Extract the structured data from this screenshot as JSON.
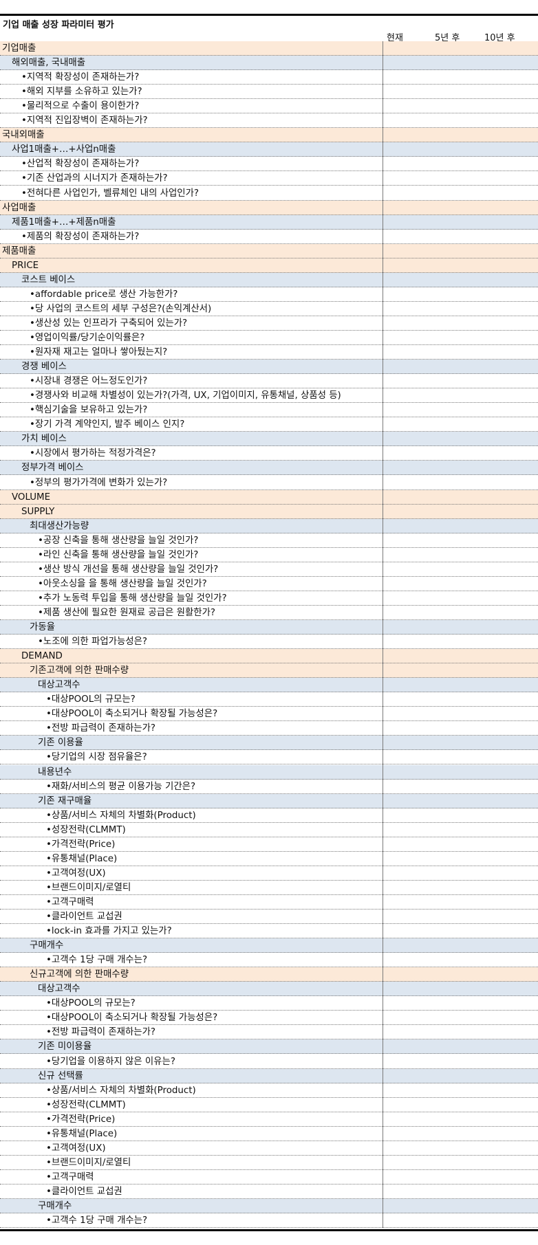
{
  "title": "기업 매출 성장 파라미터 평가",
  "columns": [
    "현재",
    "5년 후",
    "10년 후"
  ],
  "colors": {
    "orange_row": "#fce9d8",
    "blue_row": "#dde6f0"
  },
  "rows": [
    {
      "text": "기업매출",
      "indent": 0,
      "style": "a"
    },
    {
      "text": "해외매출, 국내매출",
      "indent": 1,
      "style": "b"
    },
    {
      "text": "•지역적 확장성이 존재하는가?",
      "indent": 2,
      "style": "c"
    },
    {
      "text": "•해외 지부를 소유하고 있는가?",
      "indent": 2,
      "style": "c"
    },
    {
      "text": "•물리적으로 수출이 용이한가?",
      "indent": 2,
      "style": "c"
    },
    {
      "text": "•지역적 진입장벽이 존재하는가?",
      "indent": 2,
      "style": "c"
    },
    {
      "text": "국내외매출",
      "indent": 0,
      "style": "a"
    },
    {
      "text": "사업1매출+…+사업n매출",
      "indent": 1,
      "style": "b"
    },
    {
      "text": "•산업적 확장성이 존재하는가?",
      "indent": 2,
      "style": "c"
    },
    {
      "text": "•기존 산업과의 시너지가 존재하는가?",
      "indent": 2,
      "style": "c"
    },
    {
      "text": "•전혀다른 사업인가, 벨류체인 내의 사업인가?",
      "indent": 2,
      "style": "c"
    },
    {
      "text": "사업매출",
      "indent": 0,
      "style": "a"
    },
    {
      "text": "제품1매출+…+제품n매출",
      "indent": 1,
      "style": "b"
    },
    {
      "text": "•제품의 확장성이 존재하는가?",
      "indent": 2,
      "style": "c"
    },
    {
      "text": "제품매출",
      "indent": 0,
      "style": "a"
    },
    {
      "text": "PRICE",
      "indent": 1,
      "style": "a"
    },
    {
      "text": "코스트 베이스",
      "indent": 2,
      "style": "b"
    },
    {
      "text": "•affordable price로 생산 가능한가?",
      "indent": 3,
      "style": "c"
    },
    {
      "text": "•당 사업의 코스트의 세부 구성은?(손익계산서)",
      "indent": 3,
      "style": "c"
    },
    {
      "text": "•생산성 있는 인프라가 구축되어 있는가?",
      "indent": 3,
      "style": "c"
    },
    {
      "text": "•영업이익률/당기순이익률은?",
      "indent": 3,
      "style": "c"
    },
    {
      "text": "•원자재 재고는 얼마나 쌓아뒀는지?",
      "indent": 3,
      "style": "c"
    },
    {
      "text": "경쟁 베이스",
      "indent": 2,
      "style": "b"
    },
    {
      "text": "•시장내 경쟁은 어느정도인가?",
      "indent": 3,
      "style": "c"
    },
    {
      "text": "•경쟁사와 비교해 차별성이 있는가?(가격, UX, 기업이미지, 유통채널, 상품성 등)",
      "indent": 3,
      "style": "c"
    },
    {
      "text": "•핵심기술을 보유하고 있는가?",
      "indent": 3,
      "style": "c"
    },
    {
      "text": "•장기 가격 계약인지, 발주 베이스 인지?",
      "indent": 3,
      "style": "c"
    },
    {
      "text": "가치 베이스",
      "indent": 2,
      "style": "b"
    },
    {
      "text": "•시장에서 평가하는 적정가격은?",
      "indent": 3,
      "style": "c"
    },
    {
      "text": "정부가격 베이스",
      "indent": 2,
      "style": "b"
    },
    {
      "text": "•정부의 평가가격에 변화가 있는가?",
      "indent": 3,
      "style": "c"
    },
    {
      "text": "VOLUME",
      "indent": 1,
      "style": "a"
    },
    {
      "text": "SUPPLY",
      "indent": 2,
      "style": "a"
    },
    {
      "text": "최대생산가능량",
      "indent": 3,
      "style": "b"
    },
    {
      "text": "•공장 신축을 통해 생산량을 늘일 것인가?",
      "indent": 4,
      "style": "c"
    },
    {
      "text": "•라인 신축을 통해 생산량을 늘일 것인가?",
      "indent": 4,
      "style": "c"
    },
    {
      "text": "•생산 방식 개선을 통해 생산량을 늘일 것인가?",
      "indent": 4,
      "style": "c"
    },
    {
      "text": "•아웃소싱을 을 통해 생산량을 늘일 것인가?",
      "indent": 4,
      "style": "c"
    },
    {
      "text": "•추가 노동력 투입을 통해 생산량을 늘일 것인가?",
      "indent": 4,
      "style": "c"
    },
    {
      "text": "•제품 생산에 필요한 원재료 공급은 원활한가?",
      "indent": 4,
      "style": "c"
    },
    {
      "text": "가동율",
      "indent": 3,
      "style": "b"
    },
    {
      "text": "•노조에 의한 파업가능성은?",
      "indent": 4,
      "style": "c"
    },
    {
      "text": "DEMAND",
      "indent": 2,
      "style": "a"
    },
    {
      "text": "기존고객에 의한 판매수량",
      "indent": 3,
      "style": "a"
    },
    {
      "text": "대상고객수",
      "indent": 4,
      "style": "b"
    },
    {
      "text": "•대상POOL의 규모는?",
      "indent": 5,
      "style": "c"
    },
    {
      "text": "•대상POOL이 축소되거나 확장될 가능성은?",
      "indent": 5,
      "style": "c"
    },
    {
      "text": "•전방 파급력이 존재하는가?",
      "indent": 5,
      "style": "c"
    },
    {
      "text": "기존 이용율",
      "indent": 4,
      "style": "b"
    },
    {
      "text": "•당기업의 시장 점유율은?",
      "indent": 5,
      "style": "c"
    },
    {
      "text": "내용년수",
      "indent": 4,
      "style": "b"
    },
    {
      "text": "•재화/서비스의 평균 이용가능 기간은?",
      "indent": 5,
      "style": "c"
    },
    {
      "text": "기존 재구매율",
      "indent": 4,
      "style": "b"
    },
    {
      "text": "•상품/서비스 자체의 차별화(Product)",
      "indent": 5,
      "style": "c"
    },
    {
      "text": "•성장전략(CLMMT)",
      "indent": 5,
      "style": "c"
    },
    {
      "text": "•가격전략(Price)",
      "indent": 5,
      "style": "c"
    },
    {
      "text": "•유통채널(Place)",
      "indent": 5,
      "style": "c"
    },
    {
      "text": "•고객여정(UX)",
      "indent": 5,
      "style": "c"
    },
    {
      "text": "•브랜드이미지/로열티",
      "indent": 5,
      "style": "c"
    },
    {
      "text": "•고객구매력",
      "indent": 5,
      "style": "c"
    },
    {
      "text": "•클라이언트 교섭권",
      "indent": 5,
      "style": "c"
    },
    {
      "text": "•lock-in 효과를 가지고 있는가?",
      "indent": 5,
      "style": "c"
    },
    {
      "text": "구매개수",
      "indent": 3,
      "style": "b"
    },
    {
      "text": "•고객수 1당 구매 개수는?",
      "indent": 5,
      "style": "c"
    },
    {
      "text": "신규고객에 의한 판매수량",
      "indent": 3,
      "style": "a"
    },
    {
      "text": "대상고객수",
      "indent": 4,
      "style": "b"
    },
    {
      "text": "•대상POOL의 규모는?",
      "indent": 5,
      "style": "c"
    },
    {
      "text": "•대상POOL이 축소되거나 확장될 가능성은?",
      "indent": 5,
      "style": "c"
    },
    {
      "text": "•전방 파급력이 존재하는가?",
      "indent": 5,
      "style": "c"
    },
    {
      "text": "기존 미이용율",
      "indent": 4,
      "style": "b"
    },
    {
      "text": "•당기업을 이용하지 않은 이유는?",
      "indent": 5,
      "style": "c"
    },
    {
      "text": "신규 선택률",
      "indent": 4,
      "style": "b"
    },
    {
      "text": "•상품/서비스 자체의 차별화(Product)",
      "indent": 5,
      "style": "c"
    },
    {
      "text": "•성장전략(CLMMT)",
      "indent": 5,
      "style": "c"
    },
    {
      "text": "•가격전략(Price)",
      "indent": 5,
      "style": "c"
    },
    {
      "text": "•유통채널(Place)",
      "indent": 5,
      "style": "c"
    },
    {
      "text": "•고객여정(UX)",
      "indent": 5,
      "style": "c"
    },
    {
      "text": "•브랜드이미지/로열티",
      "indent": 5,
      "style": "c"
    },
    {
      "text": "•고객구매력",
      "indent": 5,
      "style": "c"
    },
    {
      "text": "•클라이언트 교섭권",
      "indent": 5,
      "style": "c"
    },
    {
      "text": "구매개수",
      "indent": 4,
      "style": "b"
    },
    {
      "text": "•고객수 1당 구매 개수는?",
      "indent": 5,
      "style": "c"
    }
  ]
}
